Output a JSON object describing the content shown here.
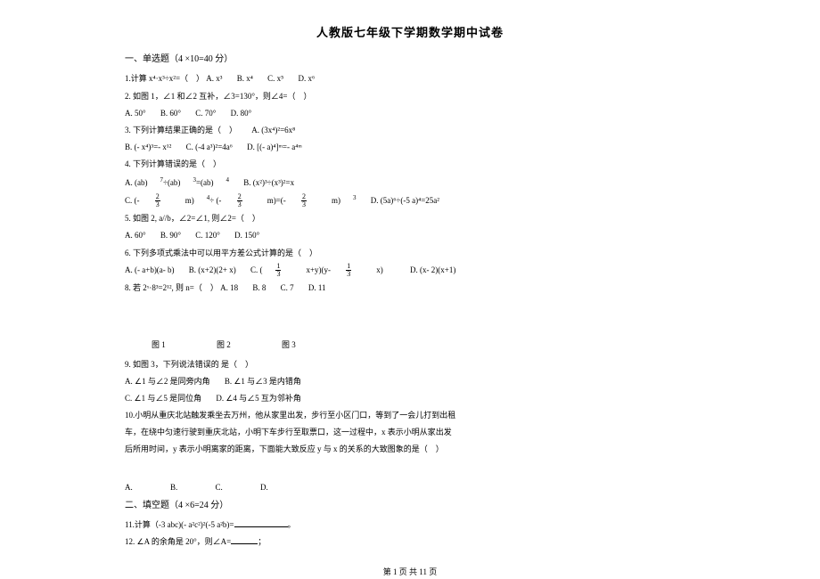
{
  "title": "人教版七年级下学期数学期中试卷",
  "section1": "一、单选题（4 ×10=40 分）",
  "q1": {
    "text": "1.计算 x⁴·x³÷x²=（　）",
    "a": "A. x³",
    "b": "B. x⁴",
    "c": "C. x⁵",
    "d": "D. x⁶"
  },
  "q2": {
    "text": "2. 如图 1，∠1 和∠2 互补，∠3=130°，则∠4=（　）",
    "a": "A. 50°",
    "b": "B. 60°",
    "c": "C. 70°",
    "d": "D. 80°"
  },
  "q3": {
    "text": "3. 下列计算结果正确的是（　）",
    "a": "A. (3x⁴)²=6x⁸",
    "b": "B. (- x⁴)³=- x¹²",
    "c": "C. (-4 a³)²=4a⁶",
    "d": "D. [(- a)⁴]ᵐ=- a⁴ᵐ"
  },
  "q4": {
    "text": "4. 下列计算错误的是（　）",
    "a_pre": "A. (ab)",
    "a_sup1": "7",
    "a_mid1": "÷(ab)",
    "a_sup2": "3",
    "a_mid2": "=(ab)",
    "a_sup3": "4",
    "b": "B. (x²)³÷(x³)²=x",
    "c_pre": "C. (- ",
    "c_n1": "2",
    "c_d1": "3",
    "c_mid1": "m)",
    "c_sup1": "4",
    "c_mid2": "÷ (- ",
    "c_n2": "2",
    "c_d2": "3",
    "c_mid3": "m)=(- ",
    "c_n3": "2",
    "c_d3": "3",
    "c_mid4": "m)",
    "c_sup2": "3",
    "d": "D. (5a)⁶÷(-5 a)⁴=25a²"
  },
  "q5": {
    "text": "5. 如图 2, a//b，∠2=∠1, 则∠2=（　）",
    "a": "A. 60°",
    "b": "B. 90°",
    "c": "C. 120°",
    "d": "D. 150°"
  },
  "q6": {
    "text": "6. 下列多项式乘法中可以用平方差公式计算的是（　）",
    "a": "A. (- a+b)(a- b)",
    "b": "B. (x+2)(2+ x)",
    "c_pre": "C. (",
    "c_n1": "1",
    "c_d1": "3",
    "c_mid": "x+y)(y- ",
    "c_n2": "1",
    "c_d2": "3",
    "c_post": "x)",
    "d": "D. (x- 2)(x+1)"
  },
  "q8": {
    "text": "8. 若 2ˣ·8³=2¹², 则 n=（　）",
    "a": "A. 18",
    "b": "B. 8",
    "c": "C. 7",
    "d": "D. 11"
  },
  "figs": {
    "f1": "图 1",
    "f2": "图 2",
    "f3": "图 3"
  },
  "q9": {
    "text": "9. 如图 3，下列说法错误的 是（　）",
    "a": "A. ∠1 与∠2 是同旁内角",
    "b": "B. ∠1 与∠3 是内错角",
    "c": "C. ∠1 与∠5 是同位角",
    "d": "D. ∠4 与∠5 互为邻补角"
  },
  "q10": {
    "line1": "10.小明从重庆北站触发乘坐去万州，他从家里出发，步行至小区门口，等到了一会儿打到出租",
    "line2": "车，在绕中匀速行驶到重庆北站，小明下车步行至取票口，这一过程中，x 表示小明从家出发",
    "line3": "后所用时间，y 表示小明离家的距离，下面能大致反应 y 与 x 的关系的大致图象的是（　）",
    "a": "A.",
    "b": "B.",
    "c": "C.",
    "d": "D."
  },
  "section2": "二、填空题（4 ×6=24 分）",
  "q11": {
    "pre": "11.计算（-3 abc)(- a²c²)²(-5 a²b)=",
    "post": "。"
  },
  "q12": {
    "pre": "12. ∠A 的余角是 20°，则∠A=",
    "post": "；"
  },
  "footer": "第 1 页 共 11 页"
}
